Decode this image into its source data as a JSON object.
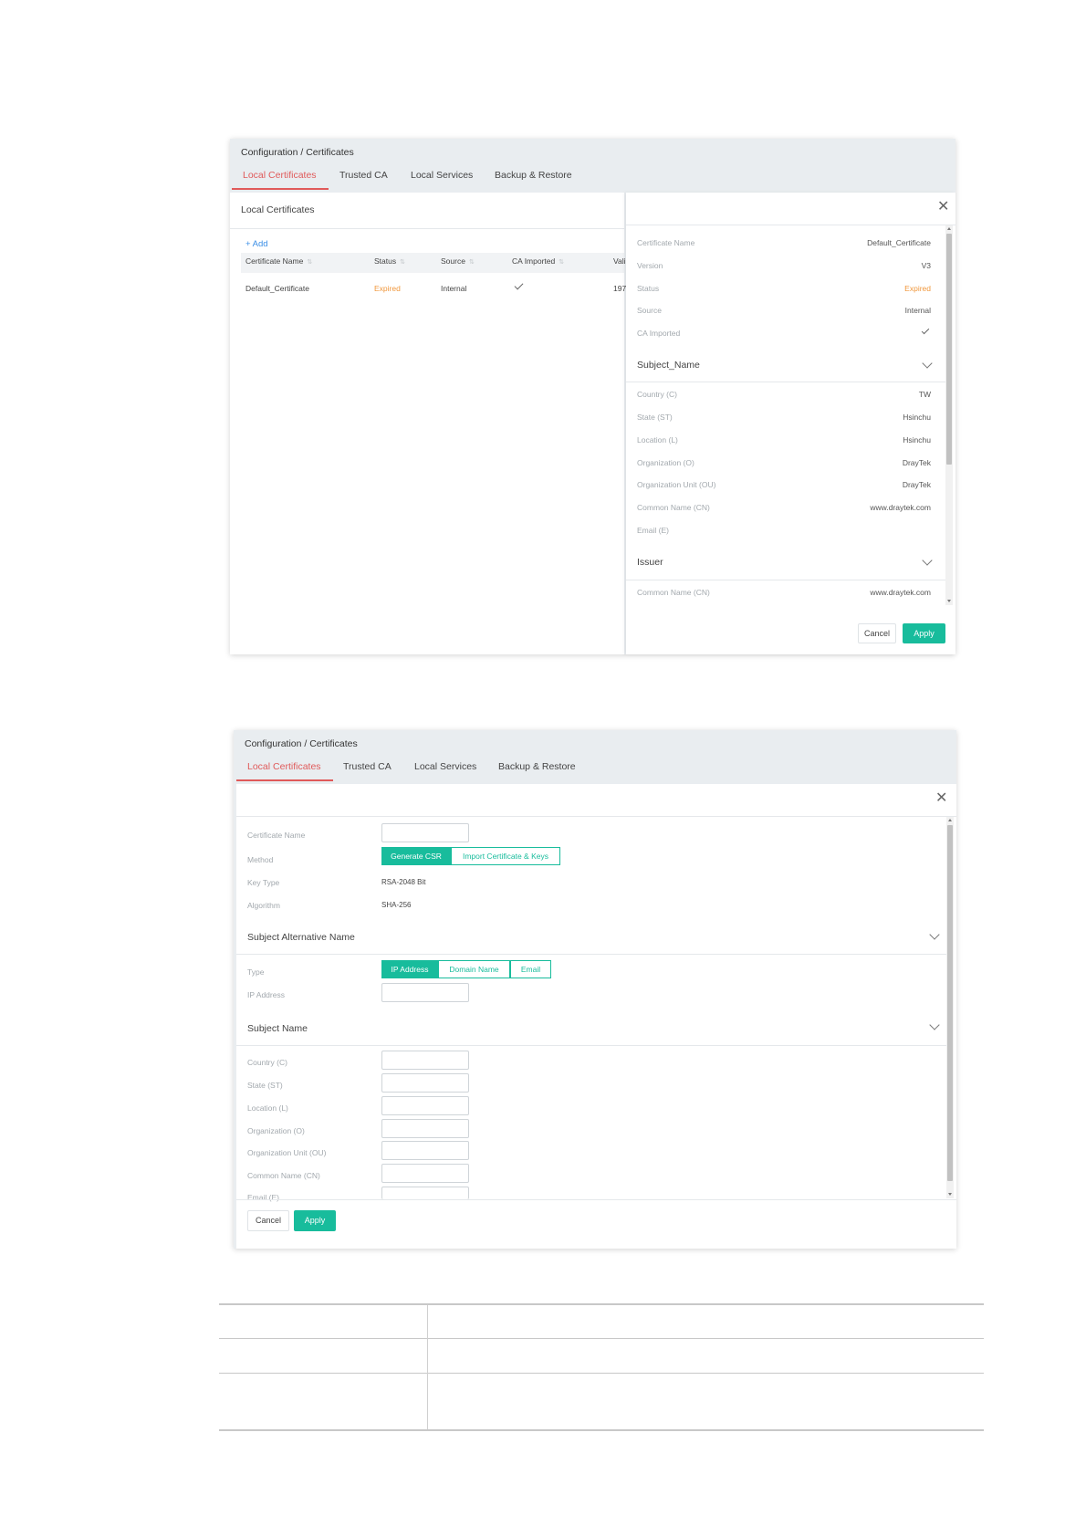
{
  "shot1": {
    "breadcrumb": "Configuration / Certificates",
    "tabs": [
      "Local Certificates",
      "Trusted CA",
      "Local Services",
      "Backup & Restore"
    ],
    "list_title": "Local Certificates",
    "add_label": "+ Add",
    "columns": [
      "Certificate Name",
      "Status",
      "Source",
      "CA Imported",
      "Vali"
    ],
    "row": {
      "name": "Default_Certificate",
      "status": "Expired",
      "source": "Internal",
      "valid": "197"
    },
    "detail": {
      "fields": [
        {
          "label": "Certificate Name",
          "value": "Default_Certificate"
        },
        {
          "label": "Version",
          "value": "V3"
        },
        {
          "label": "Status",
          "value": "Expired"
        },
        {
          "label": "Source",
          "value": "Internal"
        },
        {
          "label": "CA Imported",
          "value": ""
        }
      ],
      "subject_header": "Subject_Name",
      "subject_fields": [
        {
          "label": "Country (C)",
          "value": "TW"
        },
        {
          "label": "State (ST)",
          "value": "Hsinchu"
        },
        {
          "label": "Location (L)",
          "value": "Hsinchu"
        },
        {
          "label": "Organization (O)",
          "value": "DrayTek"
        },
        {
          "label": "Organization Unit (OU)",
          "value": "DrayTek"
        },
        {
          "label": "Common Name (CN)",
          "value": "www.draytek.com"
        },
        {
          "label": "Email (E)",
          "value": ""
        }
      ],
      "issuer_header": "Issuer",
      "issuer_fields": [
        {
          "label": "Common Name (CN)",
          "value": "www.draytek.com"
        }
      ],
      "cancel": "Cancel",
      "apply": "Apply"
    },
    "colors": {
      "accent": "#e05a5a",
      "expired": "#f0973c",
      "primary": "#18bc9c"
    }
  },
  "shot2": {
    "breadcrumb": "Configuration / Certificates",
    "tabs": [
      "Local Certificates",
      "Trusted CA",
      "Local Services",
      "Backup & Restore"
    ],
    "form": {
      "cert_name_label": "Certificate Name",
      "method_label": "Method",
      "method_options": [
        "Generate CSR",
        "Import Certificate & Keys"
      ],
      "key_type_label": "Key Type",
      "key_type_value": "RSA-2048 Bit",
      "algorithm_label": "Algorithm",
      "algorithm_value": "SHA-256",
      "san_header": "Subject Alternative Name",
      "type_label": "Type",
      "type_options": [
        "IP Address",
        "Domain Name",
        "Email"
      ],
      "ip_label": "IP Address",
      "subject_header": "Subject Name",
      "subject_labels": [
        "Country (C)",
        "State (ST)",
        "Location (L)",
        "Organization (O)",
        "Organization Unit (OU)",
        "Common Name (CN)",
        "Email (E)"
      ],
      "cancel": "Cancel",
      "apply": "Apply"
    }
  }
}
